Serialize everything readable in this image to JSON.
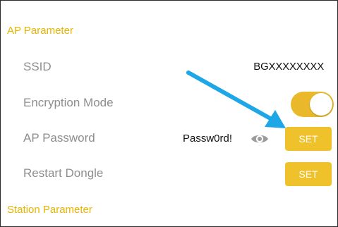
{
  "colors": {
    "accent": "#e7b400",
    "toggle_on": "#eab92b",
    "button_bg": "#efc12a",
    "label_gray": "#8e8e8e",
    "annotation_arrow": "#1ea7e6"
  },
  "sections": {
    "ap_header": "AP Parameter",
    "station_header": "Station Parameter"
  },
  "rows": {
    "ssid": {
      "label": "SSID",
      "value": "BGXXXXXXXX"
    },
    "encryption": {
      "label": "Encryption Mode",
      "toggle_state": "on"
    },
    "ap_password": {
      "label": "AP Password",
      "value": "Passw0rd!",
      "icon": "eye-icon",
      "button_label": "SET"
    },
    "restart": {
      "label": "Restart Dongle",
      "button_label": "SET"
    }
  }
}
